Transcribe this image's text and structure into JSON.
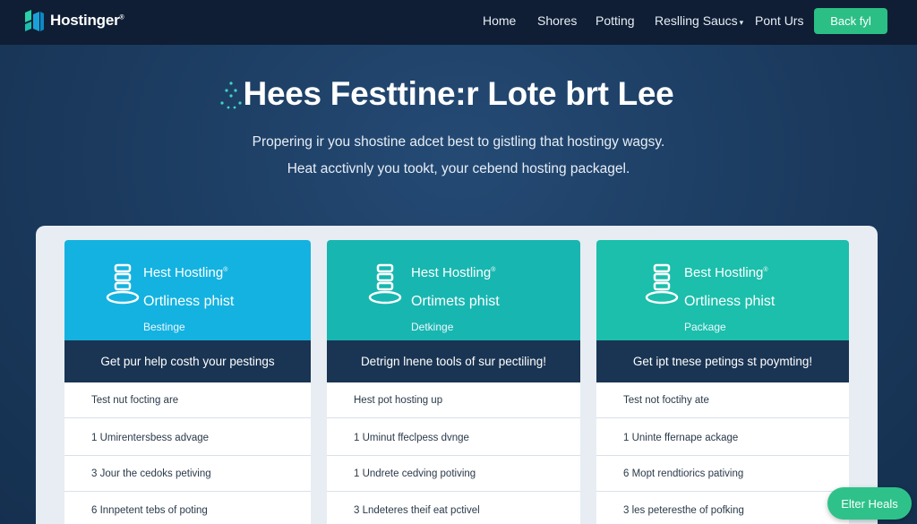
{
  "colors": {
    "navbar_bg": "#0f1e34",
    "page_bg": "#1b3a5e",
    "accent_green": "#2bbf86",
    "card1_head": "#14b2e0",
    "card2_head": "#18b6b0",
    "card3_head": "#1bbfab",
    "band_dark": "#1a3553"
  },
  "header": {
    "logo_text": "Hostinger",
    "logo_tm": "®",
    "logo_icon": "hostinger-logo-icon",
    "nav": [
      {
        "label": "Home"
      },
      {
        "label": "Shores"
      },
      {
        "label": "Potting"
      },
      {
        "label": "Reslling Saucs",
        "icon": "chevron-down-icon"
      },
      {
        "label": "Pont Urs"
      }
    ],
    "cta_label": "Back fyl"
  },
  "hero": {
    "title": "Hees Festtine:r Lote brt Lee",
    "line1": "Propering ir you shostine adcet best to gistling that hostingy wagsy.",
    "line2": "Heat acctivnly you tookt, your cebend hosting packagel."
  },
  "cards": [
    {
      "title": "Hest Hostling",
      "subtitle": "Ortliness phist",
      "tag": "Bestinge",
      "band": "Get pur help costh your pestings",
      "features": [
        "Test nut focting are",
        "1 Umirentersbess advage",
        "3 Jour the cedoks petiving",
        "6 Innpetent tebs of poting"
      ]
    },
    {
      "title": "Hest Hostling",
      "subtitle": "Ortimets phist",
      "tag": "Detkinge",
      "band": "Detrign lnene tools of sur pectiling!",
      "features": [
        "Hest pot hosting up",
        "1 Uminut ffeclpess dvnge",
        "1 Undrete cedving potiving",
        "3 Lndeteres theif eat pctivel"
      ]
    },
    {
      "title": "Best Hostling",
      "subtitle": "Ortliness phist",
      "tag": "Package",
      "band": "Get ipt tnese petings st poymting!",
      "features": [
        "Test not foctihy ate",
        "1 Uninte ffernape ackage",
        "6 Mopt rendtiorics pativing",
        "3 les peteresthe of pofking"
      ]
    }
  ],
  "float_button": "Elter Heals"
}
